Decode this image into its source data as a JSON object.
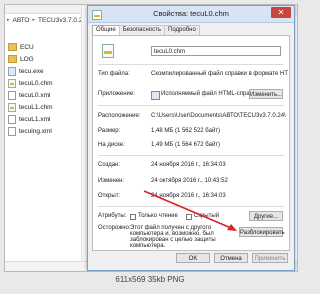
{
  "explorer": {
    "breadcrumb": [
      "АВТО",
      "TECU3v3.7.0.24"
    ],
    "files": [
      {
        "name": "ECU",
        "icon": "folder-icon"
      },
      {
        "name": "LOG",
        "icon": "folder-icon"
      },
      {
        "name": "tecu.exe",
        "icon": "exe-icon"
      },
      {
        "name": "tecuL0.chm",
        "icon": "chm-icon"
      },
      {
        "name": "tecuL0.xml",
        "icon": "xml-icon"
      },
      {
        "name": "tecuL1.chm",
        "icon": "chm-icon"
      },
      {
        "name": "tecuL1.xml",
        "icon": "xml-icon"
      },
      {
        "name": "teculng.xml",
        "icon": "xml-icon"
      }
    ]
  },
  "dialog": {
    "title": "Свойства: tecuL0.chm",
    "close_glyph": "✕",
    "tabs": [
      "Общие",
      "Безопасность",
      "Подробно"
    ],
    "filename": "tecuL0.chm",
    "type_label": "Тип файла:",
    "type_value": "Скомпилированный файл справки в формате HT",
    "app_label": "Приложение:",
    "app_value": "Исполняемый файл HTML-справ",
    "change_button": "Изменить...",
    "location_label": "Расположение:",
    "location_value": "C:\\Users\\User\\Documents\\АВТО\\TECU3v3.7.0.24\\",
    "size_label": "Размер:",
    "size_value": "1,48 МБ (1 562 522 байт)",
    "disk_label": "На диске:",
    "disk_value": "1,49 МБ (1 564 672 байт)",
    "created_label": "Создан:",
    "created_value": "24 ноября 2016 г., 16:34:03",
    "modified_label": "Изменен:",
    "modified_value": "24 октября 2016 г., 10:43:52",
    "opened_label": "Открыт:",
    "opened_value": "24 ноября 2016 г., 16:34:03",
    "attributes_label": "Атрибуты:",
    "readonly_label": "Только чтение",
    "hidden_label": "Скрытый",
    "other_button": "Другие...",
    "warning_label": "Осторожно:",
    "warning_text": [
      "Этот файл получен с другого",
      "компьютера и, возможно, был",
      "заблокирован с целью защиты",
      "компьютера."
    ],
    "unblock_button": "Разблокировать",
    "ok_button": "OK",
    "cancel_button": "Отмена",
    "apply_button": "Применить",
    "arrow_color": "#d8232a"
  },
  "footer": {
    "caption": "611x569  35kb  PNG"
  }
}
